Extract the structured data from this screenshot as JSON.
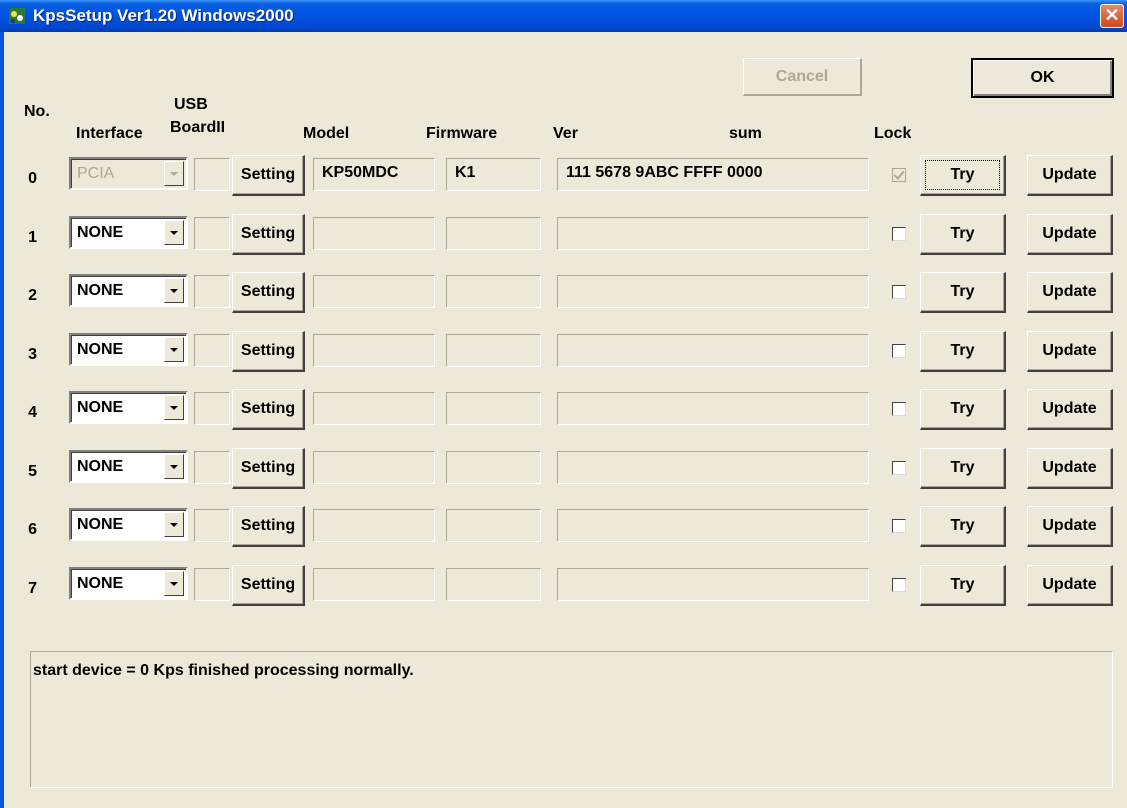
{
  "window": {
    "title": "KpsSetup Ver1.20 Windows2000",
    "close_glyph": "✕"
  },
  "toolbar": {
    "cancel_label": "Cancel",
    "ok_label": "OK"
  },
  "headers": {
    "no": "No.",
    "interface": "Interface",
    "usb_line1": "USB",
    "usb_line2": "BoardII",
    "model": "Model",
    "firmware": "Firmware",
    "ver": "Ver",
    "sum": "sum",
    "lock": "Lock"
  },
  "rows": [
    {
      "no": "0",
      "interface": "PCIA",
      "setting": "Setting",
      "model": "KP50MDC",
      "firmware": "K1",
      "ver_sum": "111 5678 9ABC FFFF 0000",
      "try": "Try",
      "update": "Update"
    },
    {
      "no": "1",
      "interface": "NONE",
      "setting": "Setting",
      "model": "",
      "firmware": "",
      "ver_sum": "",
      "try": "Try",
      "update": "Update"
    },
    {
      "no": "2",
      "interface": "NONE",
      "setting": "Setting",
      "model": "",
      "firmware": "",
      "ver_sum": "",
      "try": "Try",
      "update": "Update"
    },
    {
      "no": "3",
      "interface": "NONE",
      "setting": "Setting",
      "model": "",
      "firmware": "",
      "ver_sum": "",
      "try": "Try",
      "update": "Update"
    },
    {
      "no": "4",
      "interface": "NONE",
      "setting": "Setting",
      "model": "",
      "firmware": "",
      "ver_sum": "",
      "try": "Try",
      "update": "Update"
    },
    {
      "no": "5",
      "interface": "NONE",
      "setting": "Setting",
      "model": "",
      "firmware": "",
      "ver_sum": "",
      "try": "Try",
      "update": "Update"
    },
    {
      "no": "6",
      "interface": "NONE",
      "setting": "Setting",
      "model": "",
      "firmware": "",
      "ver_sum": "",
      "try": "Try",
      "update": "Update"
    },
    {
      "no": "7",
      "interface": "NONE",
      "setting": "Setting",
      "model": "",
      "firmware": "",
      "ver_sum": "",
      "try": "Try",
      "update": "Update"
    }
  ],
  "status": {
    "message": "start device = 0 Kps finished processing normally."
  }
}
